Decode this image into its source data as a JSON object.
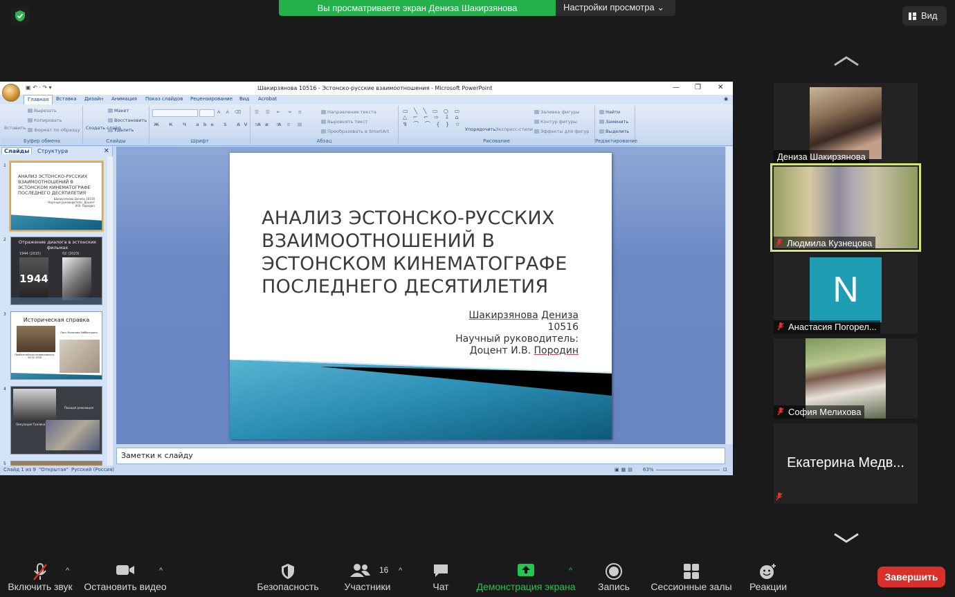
{
  "banner": {
    "text": "Вы просматриваете экран Дениза Шакирзянова",
    "settings": "Настройки просмотра"
  },
  "view_button": "Вид",
  "ppt": {
    "title": "Шакирзянова 10516 - Эстонско-русские взаимоотношения - Microsoft PowerPoint",
    "tabs": [
      "Главная",
      "Вставка",
      "Дизайн",
      "Анимация",
      "Показ слайдов",
      "Рецензирование",
      "Вид",
      "Acrobat"
    ],
    "ribbon": {
      "clipboard": {
        "paste": "Вставить",
        "cut": "Вырезать",
        "copy": "Копировать",
        "format": "Формат по образцу",
        "label": "Буфер обмена"
      },
      "slides": {
        "new": "Создать слайд",
        "layout": "Макет",
        "reset": "Восстановить",
        "delete": "Удалить",
        "label": "Слайды"
      },
      "font": {
        "label": "Шрифт"
      },
      "paragraph": {
        "direction": "Направление текста",
        "align": "Выровнять текст",
        "smartart": "Преобразовать в SmartArt",
        "label": "Абзац"
      },
      "drawing": {
        "arrange": "Упорядочить",
        "styles": "Экспресс-стили",
        "fill": "Заливка фигуры",
        "outline": "Контур фигуры",
        "effects": "Эффекты для фигур",
        "label": "Рисование"
      },
      "editing": {
        "find": "Найти",
        "replace": "Заменить",
        "select": "Выделить",
        "label": "Редактирование"
      }
    },
    "pane_tabs": {
      "slides": "Слайды",
      "outline": "Структура"
    },
    "thumbs": [
      {
        "num": "1",
        "title": "АНАЛИЗ ЭСТОНСКО-РУССКИХ ВЗАИМООТНОШЕНИЙ В ЭСТОНСКОМ КИНЕМАТОГРАФЕ ПОСЛЕДНЕГО ДЕСЯТИЛЕТИЯ",
        "sub": "Шакирзянова Дениза 10516 Научный руководитель: Доцент И.В. Породин"
      },
      {
        "num": "2",
        "title": "Отражение диалога в эстонских фильмах",
        "left": "1944 (2015)",
        "right": "02 (2023)",
        "poster": "1944"
      },
      {
        "num": "3",
        "title": "Историческая справка",
        "cap1": "Прибалтийская независимость 24.02.1918",
        "cap2": "Пакт Молотова-Риббентропа"
      },
      {
        "num": "4",
        "cap1": "Оккупация Таллина 1940",
        "cap2": "Поющая революция"
      },
      {
        "num": "5"
      }
    ],
    "slide": {
      "title": "АНАЛИЗ ЭСТОНСКО-РУССКИХ ВЗАИМООТНОШЕНИЙ В ЭСТОНСКОМ КИНЕМАТОГРАФЕ ПОСЛЕДНЕГО ДЕСЯТИЛЕТИЯ",
      "author_last": "Шакирзянова",
      "author_first": "Дениза",
      "group": "10516",
      "advisor_label": "Научный руководитель:",
      "advisor_prefix": "Доцент И.В.",
      "advisor_name": "Породин"
    },
    "notes": "Заметки к слайду",
    "status": {
      "slide": "Слайд 1 из 9",
      "theme": "\"Открытая\"",
      "lang": "Русский (Россия)",
      "zoom": "63%"
    }
  },
  "participants": [
    {
      "name": "Дениза Шакирзянова",
      "muted": false,
      "speaking": false
    },
    {
      "name": "Людмила Кузнецова",
      "muted": true,
      "speaking": true
    },
    {
      "name": "Анастасия Погорел...",
      "muted": true,
      "speaking": false,
      "initial": "N"
    },
    {
      "name": "София Мелихова",
      "muted": true,
      "speaking": false
    },
    {
      "name": "Екатерина Медв...",
      "muted": true,
      "speaking": false
    }
  ],
  "toolbar": {
    "unmute": "Включить звук",
    "stop_video": "Остановить видео",
    "security": "Безопасность",
    "participants": "Участники",
    "participants_count": "16",
    "chat": "Чат",
    "share": "Демонстрация экрана",
    "record": "Запись",
    "breakout": "Сессионные залы",
    "reactions": "Реакции",
    "end": "Завершить"
  },
  "colors": {
    "banner": "#24b04b",
    "speaking_border": "#d5e37a",
    "end": "#d9302b",
    "share": "#24c651",
    "mute": "#e0302b"
  }
}
